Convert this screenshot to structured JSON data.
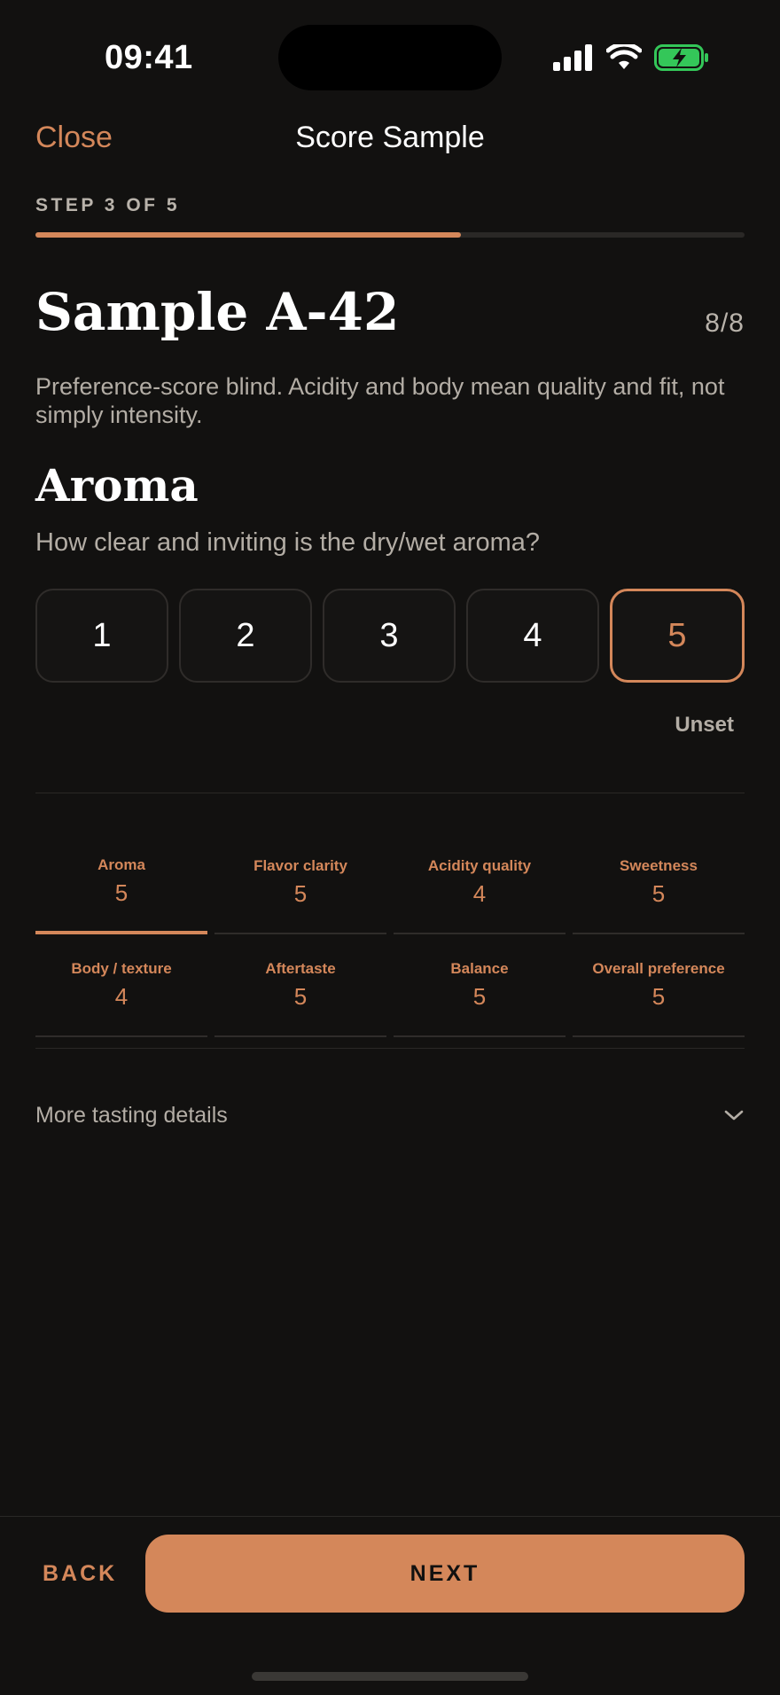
{
  "status": {
    "time": "09:41"
  },
  "nav": {
    "close_label": "Close",
    "title": "Score Sample"
  },
  "progress": {
    "step_label": "STEP 3 OF 5",
    "fraction": 0.6
  },
  "sample": {
    "title": "Sample A-42",
    "count": "8/8",
    "description": "Preference-score blind. Acidity and body mean quality and fit, not simply intensity."
  },
  "criterion": {
    "title": "Aroma",
    "question": "How clear and inviting is the dry/wet aroma?",
    "scores": [
      "1",
      "2",
      "3",
      "4",
      "5"
    ],
    "selected": "5",
    "unset_label": "Unset"
  },
  "tabs": [
    {
      "label": "Aroma",
      "value": "5"
    },
    {
      "label": "Flavor clarity",
      "value": "5"
    },
    {
      "label": "Acidity quality",
      "value": "4"
    },
    {
      "label": "Sweetness",
      "value": "5"
    },
    {
      "label": "Body / texture",
      "value": "4"
    },
    {
      "label": "Aftertaste",
      "value": "5"
    },
    {
      "label": "Balance",
      "value": "5"
    },
    {
      "label": "Overall preference",
      "value": "5"
    }
  ],
  "active_tab": 0,
  "more": {
    "label": "More tasting details",
    "icon": "chevron-down-icon"
  },
  "footer": {
    "back_label": "BACK",
    "next_label": "NEXT"
  },
  "colors": {
    "accent": "#d4875a",
    "background": "#121110",
    "battery": "#34c759"
  }
}
